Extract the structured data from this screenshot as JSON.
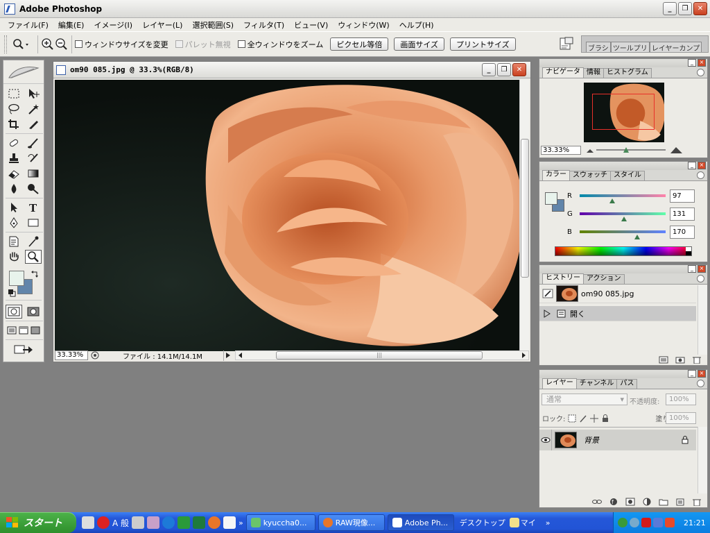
{
  "app": {
    "title": "Adobe Photoshop",
    "window_buttons": {
      "minimize": "_",
      "restore": "❐",
      "close": "✕"
    }
  },
  "menubar": {
    "items": [
      "ファイル(F)",
      "編集(E)",
      "イメージ(I)",
      "レイヤー(L)",
      "選択範囲(S)",
      "フィルタ(T)",
      "ビュー(V)",
      "ウィンドウ(W)",
      "ヘルプ(H)"
    ]
  },
  "options": {
    "resize_windows": "ウィンドウサイズを変更",
    "ignore_palettes": "パレット無視",
    "zoom_all": "全ウィンドウをズーム",
    "actual_pixels": "ピクセル等倍",
    "fit_on_screen": "画面サイズ",
    "print_size": "プリントサイズ",
    "well_tabs": [
      "ブラシ",
      "ツールプリ",
      "レイヤーカンプ"
    ]
  },
  "document": {
    "title": "om90 085.jpg @ 33.3%(RGB/8)",
    "zoom": "33.33%",
    "file_info": "ファイル : 14.1M/14.1M"
  },
  "navigator": {
    "tabs": [
      "ナビゲータ",
      "情報",
      "ヒストグラム"
    ],
    "zoom": "33.33%",
    "zoom_level": 0.43
  },
  "color": {
    "tabs": [
      "カラー",
      "スウォッチ",
      "スタイル"
    ],
    "r_label": "R",
    "g_label": "G",
    "b_label": "B",
    "r": 97,
    "g": 131,
    "b": 170,
    "r_text": "97",
    "g_text": "131",
    "b_text": "170",
    "foreground": "#e8f3ec",
    "background": "#6185aa"
  },
  "history": {
    "tabs": [
      "ヒストリー",
      "アクション"
    ],
    "snapshot": "om90 085.jpg",
    "steps": [
      "開く"
    ]
  },
  "layers": {
    "tabs": [
      "レイヤー",
      "チャンネル",
      "パス"
    ],
    "blend_mode": "通常",
    "opacity_label": "不透明度:",
    "opacity": "100%",
    "lock_label": "ロック:",
    "fill_label": "塗り:",
    "fill": "100%",
    "layer_name": "背景"
  },
  "taskbar": {
    "start": "スタート",
    "ime": "A 般",
    "buttons": [
      "kyuccha0...",
      "RAW現像...",
      "Adobe Ph..."
    ],
    "desktop": "デスクトップ",
    "mydoc": "マイ",
    "clock": "21:21"
  }
}
